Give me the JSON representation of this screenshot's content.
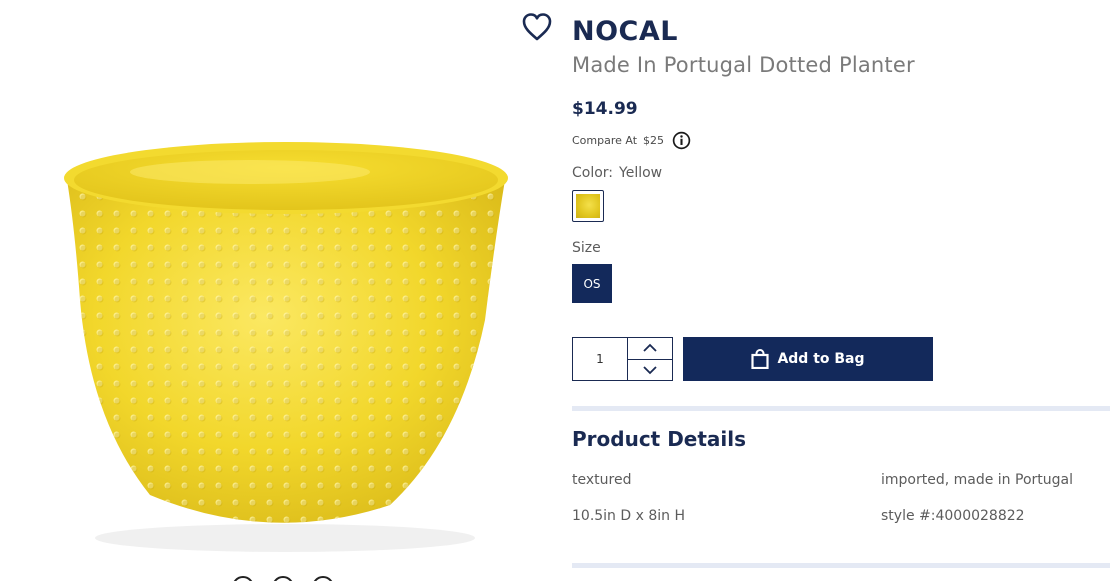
{
  "product": {
    "brand": "NOCAL",
    "name": "Made In Portugal Dotted Planter",
    "price": "$14.99",
    "compare_label": "Compare At",
    "compare_price": "$25",
    "image_icon": "yellow-dotted-planter-photo"
  },
  "icons": {
    "wishlist": "heart-icon",
    "info": "info-icon",
    "bag": "shopping-bag-icon",
    "qty_up": "chevron-up-icon",
    "qty_down": "chevron-down-icon"
  },
  "color": {
    "label": "Color:",
    "value": "Yellow",
    "swatch_hex": "#e0c51e"
  },
  "size": {
    "label": "Size",
    "options": [
      "OS"
    ],
    "selected": "OS"
  },
  "quantity": {
    "value": "1"
  },
  "actions": {
    "add_to_bag": "Add to Bag"
  },
  "details": {
    "title": "Product Details",
    "items": [
      "textured",
      "imported, made in Portugal",
      "10.5in D x 8in H",
      "style #:4000028822"
    ]
  },
  "colors": {
    "navy": "#13295b",
    "divider": "#e4e9f4",
    "planter_yellow": "#f2d72b"
  }
}
